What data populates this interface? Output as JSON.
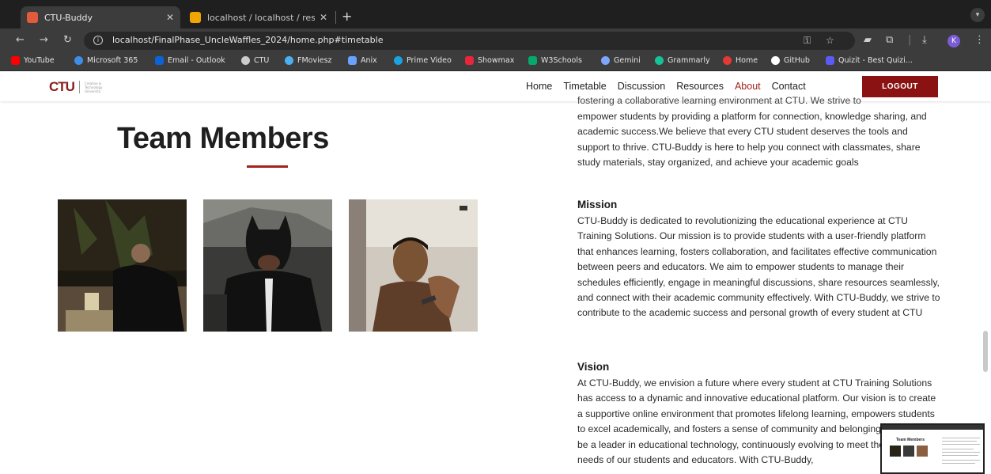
{
  "browser": {
    "tabs": [
      {
        "title": "CTU-Buddy",
        "active": true,
        "favicon_color": "#e25b3c"
      },
      {
        "title": "localhost / localhost / resourc",
        "active": false,
        "favicon_color": "#f0a500"
      }
    ],
    "url": "localhost/FinalPhase_UncleWaffles_2024/home.php#timetable",
    "profile_initial": "K",
    "bookmarks": [
      {
        "label": "YouTube",
        "color": "#ff0000"
      },
      {
        "label": "Microsoft 365",
        "color": "#3c8ee8"
      },
      {
        "label": "Email - Outlook",
        "color": "#0a64d8"
      },
      {
        "label": "CTU",
        "color": "#cccccc"
      },
      {
        "label": "FMoviesz",
        "color": "#4ab0f0"
      },
      {
        "label": "Anix",
        "color": "#6aa0ff"
      },
      {
        "label": "Prime Video",
        "color": "#1aa3e0"
      },
      {
        "label": "Showmax",
        "color": "#e8253a"
      },
      {
        "label": "W3Schools",
        "color": "#04aa6d"
      },
      {
        "label": "Gemini",
        "color": "#7fa6ff"
      },
      {
        "label": "Grammarly",
        "color": "#15c39a"
      },
      {
        "label": "Home",
        "color": "#e53935"
      },
      {
        "label": "GitHub",
        "color": "#ffffff"
      },
      {
        "label": "Quizit - Best Quizi...",
        "color": "#5b5bf5"
      }
    ]
  },
  "site": {
    "logo": {
      "mark": "CTU",
      "text": "Creative & Technology University"
    },
    "nav": [
      "Home",
      "Timetable",
      "Discussion",
      "Resources",
      "About",
      "Contact"
    ],
    "nav_active": "About",
    "logout_label": "LOGOUT",
    "accent_color": "#8a1212",
    "team_title": "Team Members",
    "about_cut_line": "fostering a collaborative learning environment at CTU. We strive to",
    "about_text": "empower students by providing a platform for connection, knowledge sharing, and academic success.We believe that every CTU student deserves the tools and support to thrive. CTU-Buddy is here to help you connect with classmates, share study materials, stay organized, and achieve your academic goals",
    "mission_heading": "Mission",
    "mission_text": "CTU-Buddy is dedicated to revolutionizing the educational experience at CTU Training Solutions. Our mission is to provide students with a user-friendly platform that enhances learning, fosters collaboration, and facilitates effective communication between peers and educators. We aim to empower students to manage their schedules efficiently, engage in meaningful discussions, share resources seamlessly, and connect with their academic community effectively. With CTU-Buddy, we strive to contribute to the academic success and personal growth of every student at CTU",
    "vision_heading": "Vision",
    "vision_text": "At CTU-Buddy, we envision a future where every student at CTU Training Solutions has access to a dynamic and innovative educational platform. Our vision is to create a supportive online environment that promotes lifelong learning, empowers students to excel academically, and fosters a sense of community and belonging. We strive to be a leader in educational technology, continuously evolving to meet the changing needs of our students and educators. With CTU-Buddy,"
  },
  "pip": {
    "title": "Team Members"
  }
}
